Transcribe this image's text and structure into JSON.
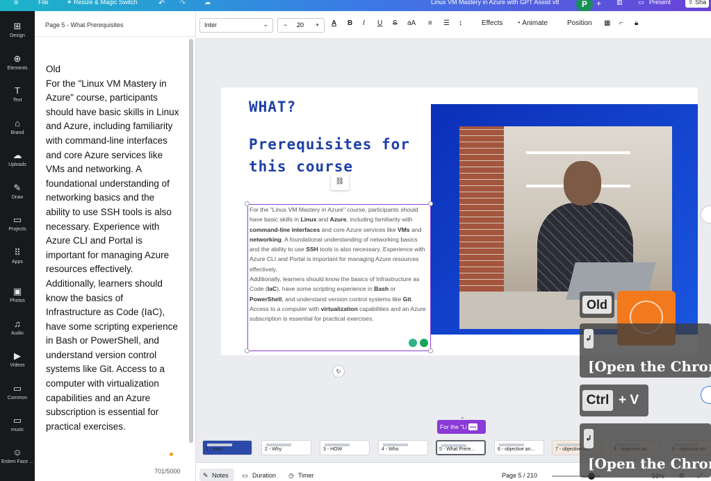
{
  "topbar": {
    "file": "File",
    "resize": "✶ Resize & Magic Switch",
    "doc_title": "Linux VM Mastery in Azure with GPT Assist v8",
    "avatar": "P",
    "present": "Present",
    "share": "Sha"
  },
  "rail": [
    {
      "icon": "⊞",
      "label": "Design"
    },
    {
      "icon": "⊕",
      "label": "Elements"
    },
    {
      "icon": "T",
      "label": "Text"
    },
    {
      "icon": "⌂",
      "label": "Brand"
    },
    {
      "icon": "☁",
      "label": "Uploads"
    },
    {
      "icon": "✎",
      "label": "Draw"
    },
    {
      "icon": "▭",
      "label": "Projects"
    },
    {
      "icon": "⠿",
      "label": "Apps"
    },
    {
      "icon": "▣",
      "label": "Photos"
    },
    {
      "icon": "♫",
      "label": "Audio"
    },
    {
      "icon": "▶",
      "label": "Videos"
    },
    {
      "icon": "▭",
      "label": "Common"
    },
    {
      "icon": "▭",
      "label": "music"
    },
    {
      "icon": "☺",
      "label": "Erdem Face ..."
    }
  ],
  "notes": {
    "title": "Page 5 - What Prerequisites",
    "text": "Old\nFor the \"Linux VM Mastery in Azure\" course, participants should have basic skills in Linux and Azure, including familiarity with command-line interfaces and core Azure services like VMs and networking. A foundational understanding of networking basics and the ability to use SSH tools is also necessary. Experience with Azure CLI and Portal is important for managing Azure resources effectively.\nAdditionally, learners should know the basics of Infrastructure as Code (IaC), have some scripting experience in Bash or PowerShell, and understand version control systems like Git. Access to a computer with virtualization capabilities and an Azure subscription is essential for practical exercises.",
    "count": "701/5000"
  },
  "toolbar": {
    "font": "Inter",
    "minus": "−",
    "size": "20",
    "plus": "+",
    "text_color": "A",
    "bold": "B",
    "italic": "I",
    "underline": "U",
    "strike": "S",
    "case": "aA",
    "effects": "Effects",
    "animate": "Animate",
    "position": "Position"
  },
  "slide": {
    "heading1": "WHAT?",
    "heading2": "Prerequisites for this course",
    "body": [
      {
        "t": "For the \"Linux VM Mastery in Azure\" course, participants should have basic skills in "
      },
      {
        "b": "Linux"
      },
      {
        "t": " and "
      },
      {
        "b": "Azure"
      },
      {
        "t": ", including familiarity with "
      },
      {
        "b": "command-line interfaces"
      },
      {
        "t": " and core Azure services like "
      },
      {
        "b": "VMs"
      },
      {
        "t": " and "
      },
      {
        "b": "networking"
      },
      {
        "t": ". A foundational understanding of networking basics and the ability to use "
      },
      {
        "b": "SSH"
      },
      {
        "t": " tools is also necessary. Experience with Azure CLI and Portal is important for managing Azure resources effectively."
      }
    ],
    "body2": [
      {
        "t": "Additionally, learners should know the basics of Infrastructure as Code ("
      },
      {
        "b": "IaC"
      },
      {
        "t": "), have some scripting experience in "
      },
      {
        "b": "Bash"
      },
      {
        "t": " or "
      },
      {
        "b": "PowerShell"
      },
      {
        "t": ", and understand version control systems like "
      },
      {
        "b": "Git"
      },
      {
        "t": ". Access to a computer with "
      },
      {
        "b": "virtualization"
      },
      {
        "t": " capabilities and an Azure subscription is essential for practical exercises."
      }
    ]
  },
  "filmstrip": {
    "chip": "For the \"Li",
    "thumbs": [
      "1 - Intro",
      "2 - Why",
      "3 - HOW",
      "4 - Who",
      "5 - What Prere...",
      "6 - objective an...",
      "7 - objective an...",
      "8 - objective an...",
      "9 - objective an"
    ]
  },
  "bottombar": {
    "notes": "Notes",
    "duration": "Duration",
    "timer": "Timer",
    "page": "Page 5 / 210",
    "zoom": "56%"
  },
  "overlays": {
    "old": "Old",
    "enter1": "↲",
    "open1": "[Open the Chron",
    "ctrl": "Ctrl",
    "plusv": "+ V",
    "enter2": "↲",
    "open2": "[Open the Chron"
  }
}
